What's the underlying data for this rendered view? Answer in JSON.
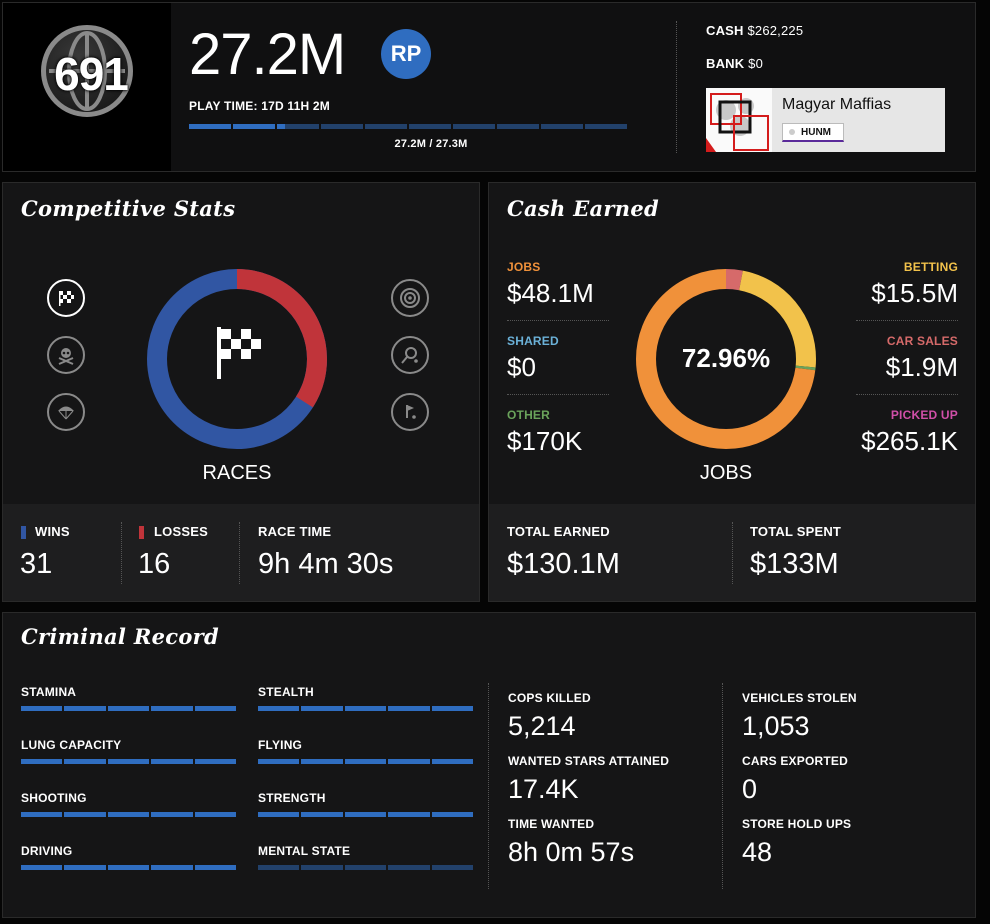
{
  "header": {
    "rank": "691",
    "rp_value": "27.2M",
    "rp_badge": "RP",
    "playtime": "PLAY TIME: 17D 11H 2M",
    "rp_progress_text": "27.2M / 27.3M",
    "rp_progress_fraction": 0.22,
    "cash_label": "CASH",
    "cash_value": "$262,225",
    "bank_label": "BANK",
    "bank_value": "$0",
    "crew_name": "Magyar Maffias",
    "crew_tag": "HUNM"
  },
  "competitive": {
    "title": "Competitive Stats",
    "donut_label": "RACES",
    "wins_label": "WINS",
    "wins_value": "31",
    "losses_label": "LOSSES",
    "losses_value": "16",
    "race_time_label": "RACE TIME",
    "race_time_value": "9h 4m 30s",
    "icons": [
      "checkered-flag-icon",
      "skull-icon",
      "parachute-icon",
      "target-icon",
      "tennis-icon",
      "golf-icon"
    ],
    "colors": {
      "wins": "#3156a3",
      "losses": "#c0343a"
    }
  },
  "cash_earned": {
    "title": "Cash Earned",
    "center_percent": "72.96%",
    "donut_label": "JOBS",
    "left": [
      {
        "label": "JOBS",
        "value": "$48.1M",
        "color": "#f0913a"
      },
      {
        "label": "SHARED",
        "value": "$0",
        "color": "#6bb1d8"
      },
      {
        "label": "OTHER",
        "value": "$170K",
        "color": "#6aa35b"
      }
    ],
    "right": [
      {
        "label": "BETTING",
        "value": "$15.5M",
        "color": "#f2c24b"
      },
      {
        "label": "CAR SALES",
        "value": "$1.9M",
        "color": "#d66a6a"
      },
      {
        "label": "PICKED UP",
        "value": "$265.1K",
        "color": "#d04fa8"
      }
    ],
    "total_earned_label": "TOTAL EARNED",
    "total_earned_value": "$130.1M",
    "total_spent_label": "TOTAL SPENT",
    "total_spent_value": "$133M"
  },
  "criminal": {
    "title": "Criminal Record",
    "skills": [
      {
        "label": "STAMINA",
        "level": 1.0
      },
      {
        "label": "STEALTH",
        "level": 1.0
      },
      {
        "label": "LUNG CAPACITY",
        "level": 1.0
      },
      {
        "label": "FLYING",
        "level": 1.0
      },
      {
        "label": "SHOOTING",
        "level": 1.0
      },
      {
        "label": "STRENGTH",
        "level": 1.0
      },
      {
        "label": "DRIVING",
        "level": 1.0
      },
      {
        "label": "MENTAL STATE",
        "level": 0.0
      }
    ],
    "stats_left": [
      {
        "label": "COPS KILLED",
        "value": "5,214"
      },
      {
        "label": "WANTED STARS ATTAINED",
        "value": "17.4K"
      },
      {
        "label": "TIME WANTED",
        "value": "8h 0m 57s"
      }
    ],
    "stats_right": [
      {
        "label": "VEHICLES STOLEN",
        "value": "1,053"
      },
      {
        "label": "CARS EXPORTED",
        "value": "0"
      },
      {
        "label": "STORE HOLD UPS",
        "value": "48"
      }
    ]
  }
}
